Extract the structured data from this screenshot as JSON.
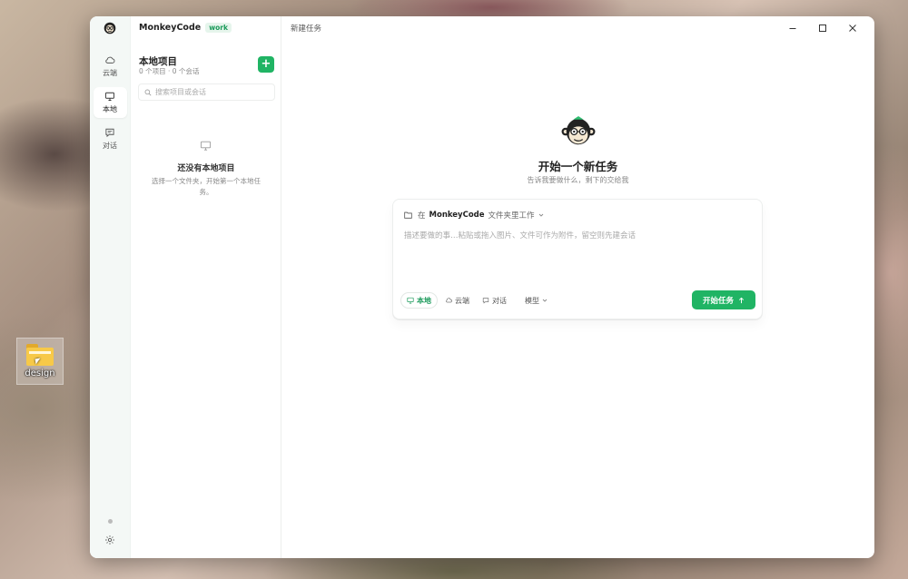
{
  "desktop": {
    "folder_label": "design"
  },
  "app": {
    "name": "MonkeyCode",
    "badge": "work"
  },
  "rail": {
    "items": [
      {
        "id": "cloud",
        "label": "云端",
        "active": false
      },
      {
        "id": "local",
        "label": "本地",
        "active": true
      },
      {
        "id": "chat",
        "label": "对话",
        "active": false
      }
    ]
  },
  "panel": {
    "title": "本地项目",
    "summary": "0 个项目 · 0 个会话",
    "add_label": "+",
    "search_placeholder": "搜索项目或会话",
    "empty_title": "还没有本地项目",
    "empty_desc": "选择一个文件夹，开始第一个本地任务。"
  },
  "main": {
    "title": "新建任务",
    "hero_title": "开始一个新任务",
    "hero_sub": "告诉我要做什么，剩下的交给我",
    "composer": {
      "prefix": "在",
      "project": "MonkeyCode",
      "suffix": "文件夹里工作",
      "placeholder": "描述要做的事…粘贴或拖入图片、文件可作为附件，留空则先建会话",
      "modes": [
        {
          "id": "local",
          "label": "本地",
          "active": true
        },
        {
          "id": "cloud",
          "label": "云端",
          "active": false
        },
        {
          "id": "chat",
          "label": "对话",
          "active": false
        }
      ],
      "model_label": "模型",
      "start_label": "开始任务"
    }
  },
  "colors": {
    "accent": "#20b464",
    "accent_text": "#1a9a5a"
  }
}
